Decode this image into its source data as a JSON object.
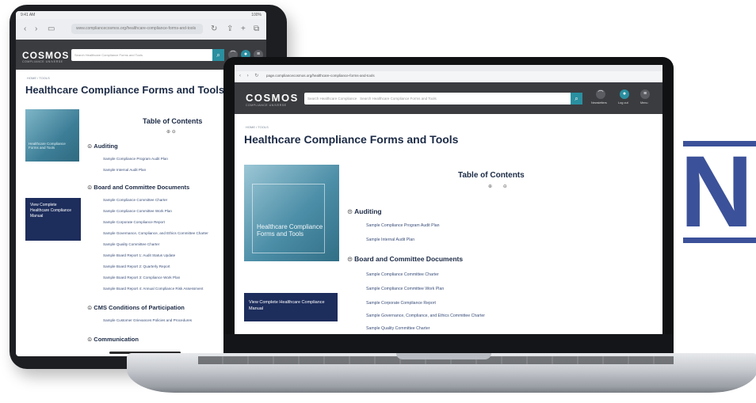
{
  "tablet": {
    "url": "www.compliancecosmos.org/healthcare-compliance-forms-and-tools",
    "brand": "COSMOS",
    "brand_sub": "COMPLIANCE UNIVERSE",
    "search_placeholder": "Search Healthcare Compliance Forms and Tools",
    "breadcrumb": "HOME / TOOLS",
    "title": "Healthcare Compliance Forms and Tools",
    "cover_label": "Healthcare Compliance Forms and Tools",
    "view_button": "View Complete Healthcare Compliance Manual",
    "toc_title": "Table of Contents",
    "toc_icons": "⊕ ⊖",
    "sections": [
      {
        "title": "Auditing",
        "links": [
          "Sample Compliance Program Audit Plan",
          "Sample Internal Audit Plan"
        ]
      },
      {
        "title": "Board and Committee Documents",
        "links": [
          "Sample Compliance Committee Charter",
          "Sample Compliance Committee Work Plan",
          "Sample Corporate Compliance Report",
          "Sample Governance, Compliance, and Ethics Committee Charter",
          "Sample Quality Committee Charter",
          "Sample Board Report 1: Audit Status Update",
          "Sample Board Report 2: Quarterly Report",
          "Sample Board Report 3: Compliance Work Plan",
          "Sample Board Report 4: Annual Compliance Risk Assessment"
        ]
      },
      {
        "title": "CMS Conditions of Participation",
        "links": [
          "Sample Customer Grievances Policies and Procedures"
        ]
      },
      {
        "title": "Communication",
        "links": []
      }
    ]
  },
  "laptop": {
    "url": "page.compliancecosmos.org/healthcare-compliance-forms-and-tools",
    "brand": "COSMOS",
    "brand_sub": "COMPLIANCE UNIVERSE",
    "search_scope": "Search Healthcare Compliance",
    "search_placeholder": "Search Healthcare Compliance Forms and Tools",
    "header_labels": [
      "Newsletters",
      "Log out",
      "Menu"
    ],
    "breadcrumb": "HOME / TOOLS",
    "title": "Healthcare Compliance Forms and Tools",
    "cover_label": "Healthcare Compliance Forms and Tools",
    "view_button": "View Complete Healthcare Compliance Manual",
    "toc_title": "Table of Contents",
    "toc_icons": "⊕ ⊖",
    "sections": [
      {
        "title": "Auditing",
        "links": [
          "Sample Compliance Program Audit Plan",
          "Sample Internal Audit Plan"
        ]
      },
      {
        "title": "Board and Committee Documents",
        "links": [
          "Sample Compliance Committee Charter",
          "Sample Compliance Committee Work Plan",
          "Sample Corporate Compliance Report",
          "Sample Governance, Compliance, and Ethics Committee Charter",
          "Sample Quality Committee Charter"
        ]
      }
    ]
  },
  "logo": {
    "letter": "N",
    "color": "#3b5199"
  },
  "colors": {
    "header": "#3b3c40",
    "accent": "#2a8fa0",
    "navy": "#1d2d5c"
  }
}
